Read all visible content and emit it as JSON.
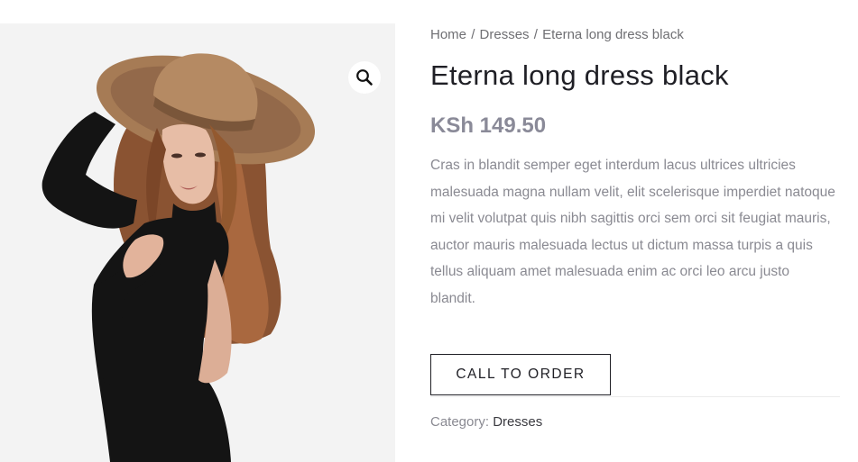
{
  "breadcrumb": {
    "items": [
      "Home",
      "Dresses",
      "Eterna long dress black"
    ],
    "separator": "/"
  },
  "product": {
    "title": "Eterna long dress black",
    "price": "KSh 149.50",
    "description": "Cras in blandit semper eget interdum lacus ultrices ultricies malesuada magna nullam velit, elit scelerisque imperdiet natoque mi velit volutpat quis nibh sagittis orci sem orci sit feugiat mauris, auctor mauris malesuada lectus ut dictum massa turpis a quis tellus aliquam amet malesuada enim ac orci leo arcu justo blandit.",
    "cta_label": "CALL TO ORDER",
    "category_label": "Category:",
    "category_value": "Dresses"
  },
  "gallery": {
    "zoom_icon": "magnifier-icon"
  },
  "colors": {
    "title": "#1f1f25",
    "price": "#8a8a98",
    "body_text": "#8a8a92",
    "image_background": "#f3f3f3"
  }
}
